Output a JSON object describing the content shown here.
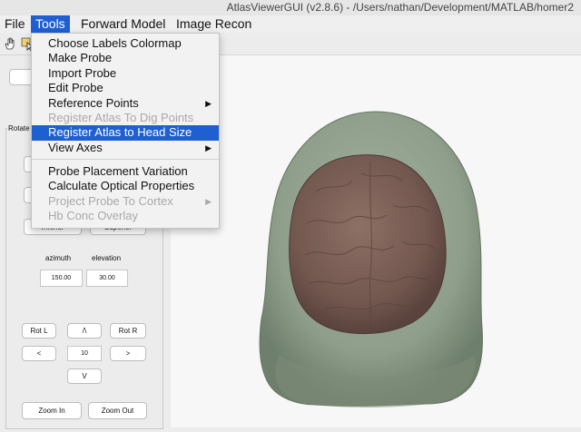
{
  "window": {
    "title": "AtlasViewerGUI  (v2.8.6) - /Users/nathan/Development/MATLAB/homer2"
  },
  "menubar": {
    "items": [
      "File",
      "Tools",
      "Forward Model",
      "Image Recon"
    ]
  },
  "toolbar": {
    "icons": [
      "hand-pan-icon",
      "data-cursor-icon"
    ]
  },
  "tools_menu": {
    "items": [
      {
        "label": "Choose Labels Colormap",
        "enabled": true,
        "submenu": false
      },
      {
        "label": "Make Probe",
        "enabled": true,
        "submenu": false
      },
      {
        "label": "Import Probe",
        "enabled": true,
        "submenu": false
      },
      {
        "label": "Edit Probe",
        "enabled": true,
        "submenu": false
      },
      {
        "label": "Reference Points",
        "enabled": true,
        "submenu": true
      },
      {
        "label": "Register Atlas To Dig Points",
        "enabled": false,
        "submenu": false
      },
      {
        "label": "Register Atlas to Head Size",
        "enabled": true,
        "submenu": false,
        "highlighted": true
      },
      {
        "label": "View Axes",
        "enabled": true,
        "submenu": true
      },
      {
        "label": "Probe Placement Variation",
        "enabled": true,
        "submenu": false
      },
      {
        "label": "Calculate Optical Properties",
        "enabled": true,
        "submenu": false
      },
      {
        "label": "Project Probe To Cortex",
        "enabled": false,
        "submenu": true
      },
      {
        "label": "Hb Conc Overlay",
        "enabled": false,
        "submenu": false
      }
    ],
    "submenu_arrow": "▶"
  },
  "panel": {
    "group_label": "Rotate",
    "inferior_label": "Inferior",
    "superior_label": "Superior",
    "azimuth_label": "azimuth",
    "elevation_label": "elevation",
    "azimuth_value": "150.00",
    "elevation_value": "30.00",
    "rotl_label": "Rot L",
    "up_label": "/\\",
    "rotr_label": "Rot R",
    "left_label": "<",
    "step_value": "10",
    "right_label": ">",
    "down_label": "V",
    "zoomin_label": "Zoom In",
    "zoomout_label": "Zoom Out"
  },
  "colors": {
    "menu_highlight": "#1f5fd1",
    "scalp": "#8e9e8a",
    "brain": "#7a5f56"
  }
}
